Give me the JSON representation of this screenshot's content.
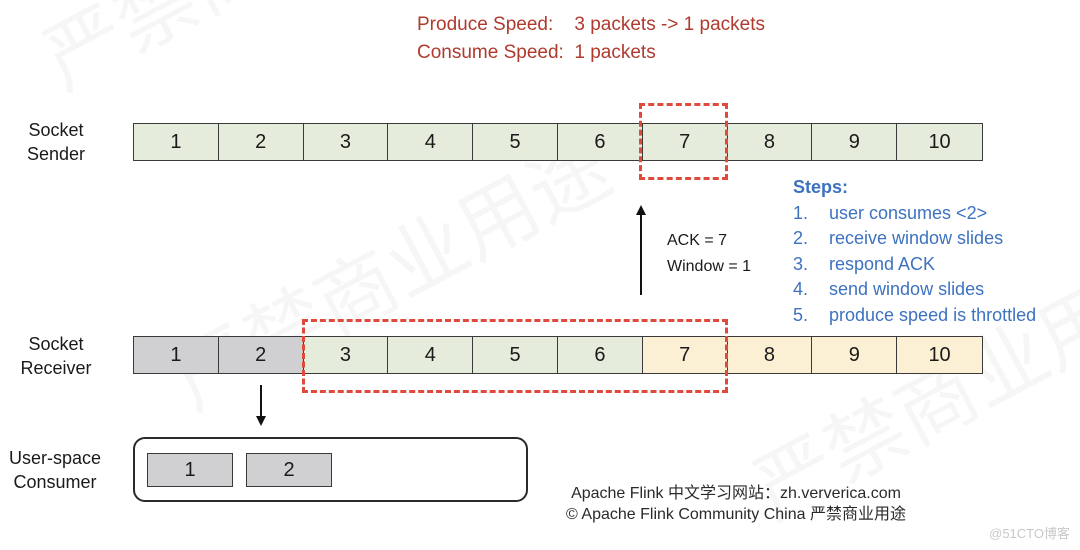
{
  "header": {
    "produce_speed": "Produce Speed:    3 packets -> 1 packets",
    "consume_speed": "Consume Speed:  1 packets"
  },
  "sender": {
    "label_line1": "Socket",
    "label_line2": "Sender",
    "cells": [
      {
        "value": "1",
        "state": "pending",
        "color": "#e5ecdb"
      },
      {
        "value": "2",
        "state": "pending",
        "color": "#e5ecdb"
      },
      {
        "value": "3",
        "state": "pending",
        "color": "#e5ecdb"
      },
      {
        "value": "4",
        "state": "pending",
        "color": "#e5ecdb"
      },
      {
        "value": "5",
        "state": "pending",
        "color": "#e5ecdb"
      },
      {
        "value": "6",
        "state": "pending",
        "color": "#e5ecdb"
      },
      {
        "value": "7",
        "state": "pending",
        "color": "#e5ecdb"
      },
      {
        "value": "8",
        "state": "pending",
        "color": "#e5ecdb"
      },
      {
        "value": "9",
        "state": "pending",
        "color": "#e5ecdb"
      },
      {
        "value": "10",
        "state": "pending",
        "color": "#e5ecdb"
      }
    ],
    "send_window": {
      "from": 7,
      "to": 7
    }
  },
  "receiver": {
    "label_line1": "Socket",
    "label_line2": "Receiver",
    "cells": [
      {
        "value": "1",
        "state": "consumed",
        "color": "#d0cfd1"
      },
      {
        "value": "2",
        "state": "consumed",
        "color": "#d0cfd1"
      },
      {
        "value": "3",
        "state": "received",
        "color": "#e5ecdb"
      },
      {
        "value": "4",
        "state": "received",
        "color": "#e5ecdb"
      },
      {
        "value": "5",
        "state": "received",
        "color": "#e5ecdb"
      },
      {
        "value": "6",
        "state": "received",
        "color": "#e5ecdb"
      },
      {
        "value": "7",
        "state": "free",
        "color": "#fbf0d4"
      },
      {
        "value": "8",
        "state": "free",
        "color": "#fbf0d4"
      },
      {
        "value": "9",
        "state": "free",
        "color": "#fbf0d4"
      },
      {
        "value": "10",
        "state": "free",
        "color": "#fbf0d4"
      }
    ],
    "receive_window": {
      "from": 3,
      "to": 7
    }
  },
  "ack": {
    "line1": "ACK = 7",
    "line2": "Window = 1"
  },
  "steps": {
    "title": "Steps:",
    "items": [
      {
        "num": "1.",
        "text": "user consumes <2>"
      },
      {
        "num": "2.",
        "text": "receive window slides"
      },
      {
        "num": "3.",
        "text": "respond ACK"
      },
      {
        "num": "4.",
        "text": "send window slides"
      },
      {
        "num": "5.",
        "text": "produce speed is throttled"
      }
    ]
  },
  "consumer": {
    "label_line1": "User-space",
    "label_line2": "Consumer",
    "packets": [
      "1",
      "2"
    ]
  },
  "footer": {
    "line1": "Apache Flink 中文学习网站：zh.ververica.com",
    "line2": "© Apache Flink Community China  严禁商业用途"
  },
  "credit": "@51CTO博客",
  "watermark": "严禁商业用途",
  "colors": {
    "header_red": "#b03a2e",
    "steps_blue": "#3d72bf",
    "window_dash": "#e04a3a"
  }
}
